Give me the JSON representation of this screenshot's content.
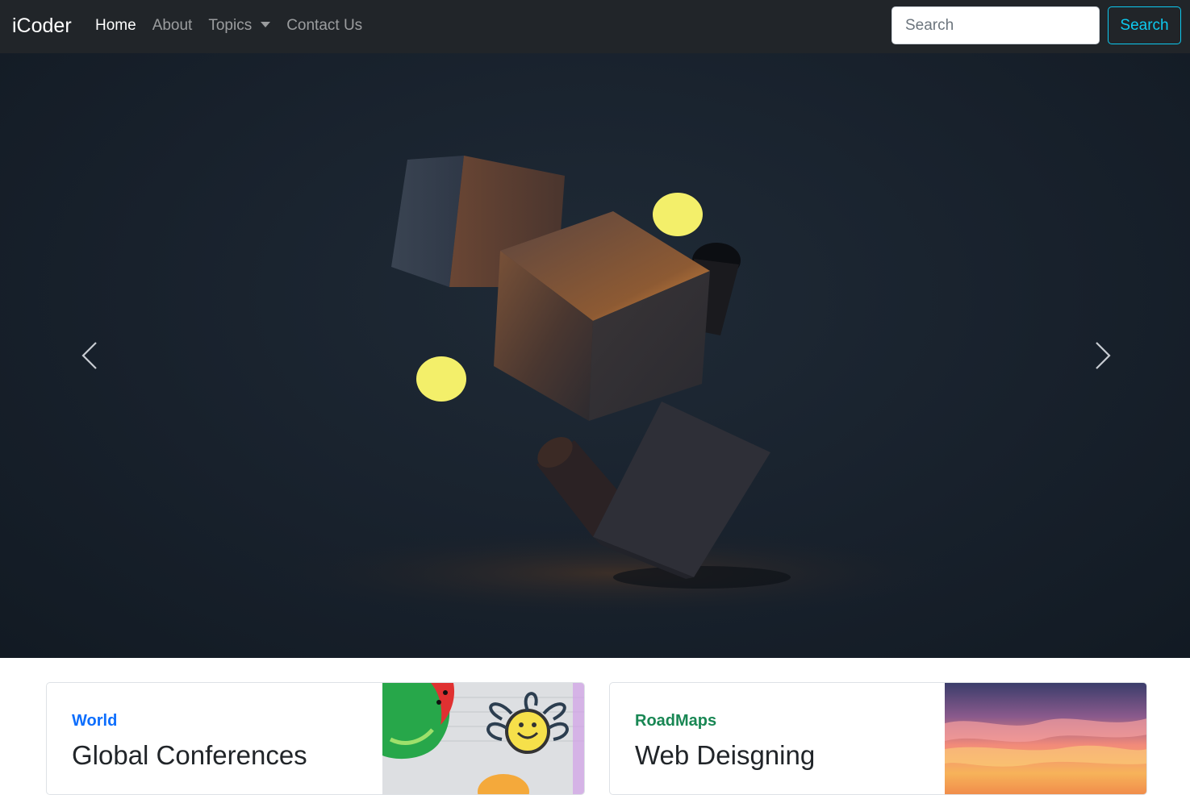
{
  "navbar": {
    "brand": "iCoder",
    "links": [
      {
        "label": "Home",
        "active": true
      },
      {
        "label": "About",
        "active": false
      },
      {
        "label": "Topics",
        "active": false,
        "dropdown": true
      },
      {
        "label": "Contact Us",
        "active": false
      }
    ],
    "search": {
      "placeholder": "Search",
      "value": "",
      "button_label": "Search"
    }
  },
  "carousel": {
    "controls": {
      "prev_icon": "chevron-left-icon",
      "next_icon": "chevron-right-icon"
    }
  },
  "cards": [
    {
      "category": "World",
      "title": "Global Conferences",
      "category_color": "#0d6efd"
    },
    {
      "category": "RoadMaps",
      "title": "Web Deisgning",
      "category_color": "#198754"
    }
  ],
  "colors": {
    "navbar_bg": "#212529",
    "search_accent": "#0dcaf0"
  }
}
